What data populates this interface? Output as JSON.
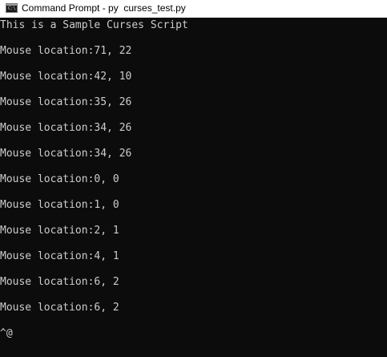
{
  "window": {
    "title": "Command Prompt - py  curses_test.py",
    "icon": "command-prompt-icon",
    "icon_glyph": "C:\\"
  },
  "console": {
    "lines": [
      "This is a Sample Curses Script",
      "Mouse location:71, 22",
      "Mouse location:42, 10",
      "Mouse location:35, 26",
      "Mouse location:34, 26",
      "Mouse location:34, 26",
      "Mouse location:0, 0",
      "Mouse location:1, 0",
      "Mouse location:2, 1",
      "Mouse location:4, 1",
      "Mouse location:6, 2",
      "Mouse location:6, 2",
      "^@"
    ]
  },
  "colors": {
    "console_background": "#0c0c0c",
    "console_text": "#cccccc",
    "titlebar_background": "#ffffff"
  }
}
